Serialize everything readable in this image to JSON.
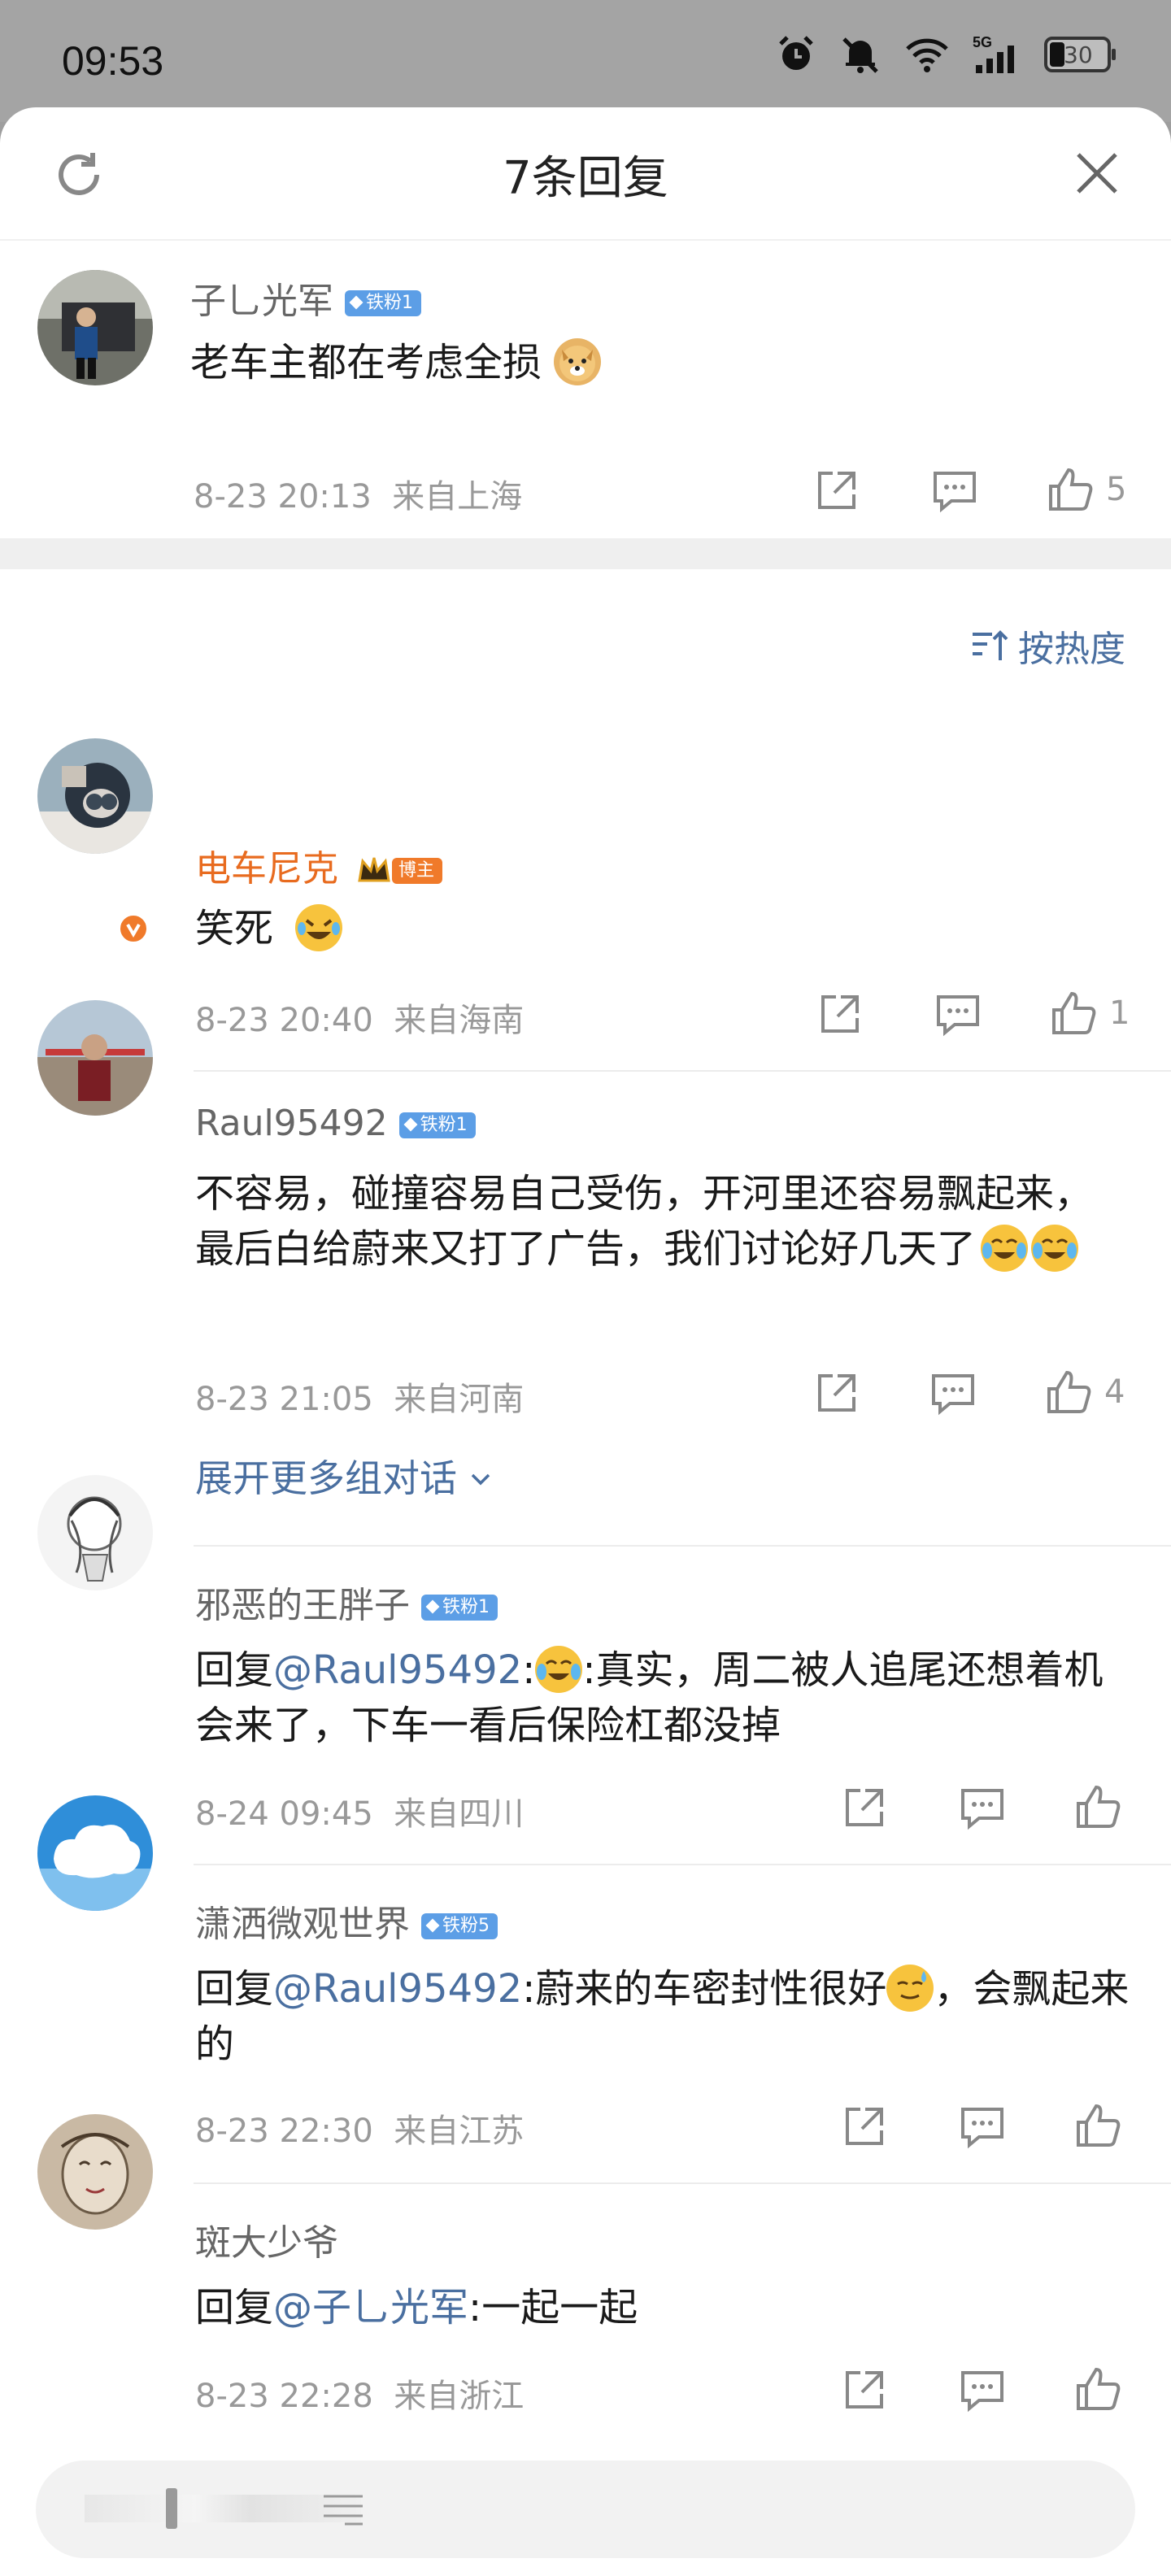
{
  "status_bar": {
    "time": "09:53",
    "battery": "30"
  },
  "sheet": {
    "title": "7条回复"
  },
  "original": {
    "user": "子乚光军",
    "badge": "铁粉1",
    "text": "老车主都在考虑全损",
    "date": "8-23 20:13",
    "location": "来自上海",
    "likes": "5"
  },
  "sort": {
    "label": "按热度"
  },
  "replies": [
    {
      "user": "电车尼克",
      "badge": "博主",
      "text": "笑死",
      "date": "8-23 20:40",
      "location": "来自海南",
      "likes": "1"
    },
    {
      "user": "Raul95492",
      "badge": "铁粉1",
      "text": "不容易，碰撞容易自己受伤，开河里还容易飘起来，最后白给蔚来又打了广告，我们讨论好几天了",
      "date": "8-23 21:05",
      "location": "来自河南",
      "likes": "4",
      "expand": "展开更多组对话"
    },
    {
      "user": "邪恶的王胖子",
      "badge": "铁粉1",
      "prefix": "回复",
      "mention": "@Raul95492",
      "text": ":真实，周二被人追尾还想着机会来了，下车一看后保险杠都没掉",
      "date": "8-24 09:45",
      "location": "来自四川"
    },
    {
      "user": "潇洒微观世界",
      "badge": "铁粉5",
      "prefix": "回复",
      "mention": "@Raul95492",
      "text_a": ":蔚来的车密封性很好",
      "text_b": "，会飘起来的",
      "date": "8-23 22:30",
      "location": "来自江苏"
    },
    {
      "user": "斑大少爷",
      "prefix": "回复",
      "mention": "@子乚光军",
      "text": ":一起一起",
      "date": "8-23 22:28",
      "location": "来自浙江"
    }
  ],
  "colors": {
    "accent": "#4a6fa0",
    "blogger": "#e86b1f",
    "badge": "#5c9ee6"
  }
}
